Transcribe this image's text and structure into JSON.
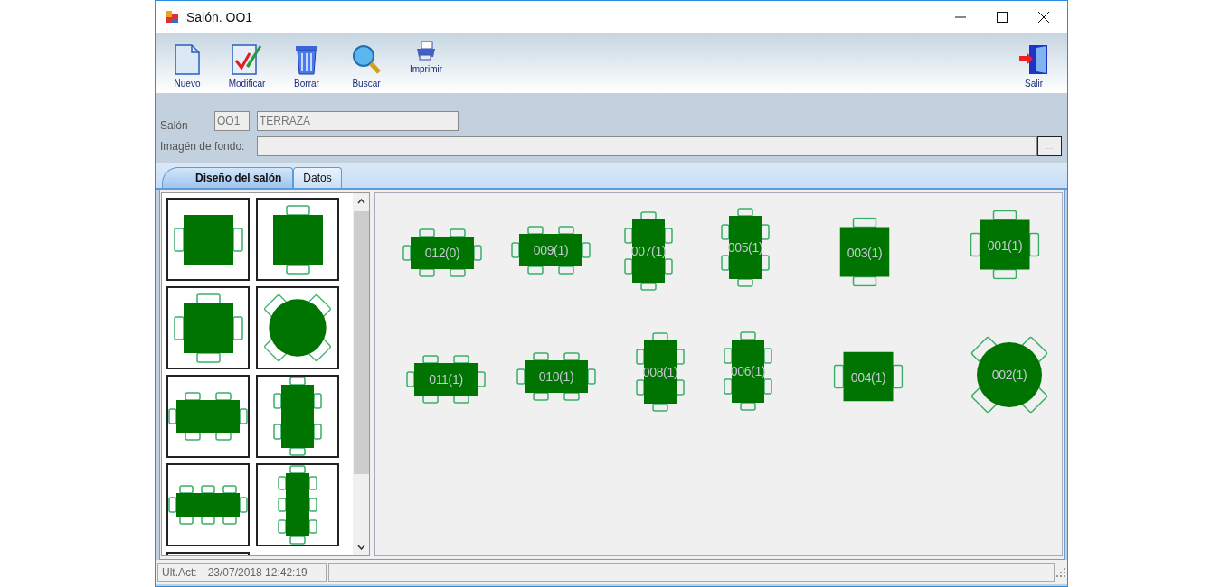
{
  "window": {
    "title": "Salón. OO1"
  },
  "toolbar": [
    {
      "label": "Nuevo",
      "kind": "new"
    },
    {
      "label": "Modificar",
      "kind": "edit"
    },
    {
      "label": "Borrar",
      "kind": "delete"
    },
    {
      "label": "Buscar",
      "kind": "search"
    },
    {
      "label": "Imprimir",
      "kind": "print"
    },
    {
      "label": "Salir",
      "kind": "exit"
    }
  ],
  "form": {
    "salon_label": "Salón",
    "salon_code": "OO1",
    "salon_name": "TERRAZA",
    "background_label": "Imagén de fondo:",
    "browse_button": "..."
  },
  "tabs": [
    {
      "label": "Diseño del salón",
      "selected": true
    },
    {
      "label": "Datos",
      "selected": false
    }
  ],
  "palette": [
    {
      "kind": "square-2h"
    },
    {
      "kind": "square-2v"
    },
    {
      "kind": "square-4"
    },
    {
      "kind": "round-4"
    },
    {
      "kind": "rect-h"
    },
    {
      "kind": "rect-v"
    },
    {
      "kind": "rect-h8"
    },
    {
      "kind": "rect-v8"
    },
    {
      "kind": "other"
    }
  ],
  "tables": [
    {
      "label": "012(0)",
      "kind": "rect-h"
    },
    {
      "label": "009(1)",
      "kind": "rect-h"
    },
    {
      "label": "007(1)",
      "kind": "rect-v"
    },
    {
      "label": "005(1)",
      "kind": "rect-v"
    },
    {
      "label": "003(1)",
      "kind": "square-2v"
    },
    {
      "label": "001(1)",
      "kind": "square-4"
    },
    {
      "label": "011(1)",
      "kind": "rect-h"
    },
    {
      "label": "010(1)",
      "kind": "rect-h"
    },
    {
      "label": "008(1)",
      "kind": "rect-v"
    },
    {
      "label": "006(1)",
      "kind": "rect-v"
    },
    {
      "label": "004(1)",
      "kind": "square-2h"
    },
    {
      "label": "002(1)",
      "kind": "round-4"
    }
  ],
  "status_bar": {
    "label": "Ult.Act:",
    "value": "23/07/2018 12:42:19"
  }
}
